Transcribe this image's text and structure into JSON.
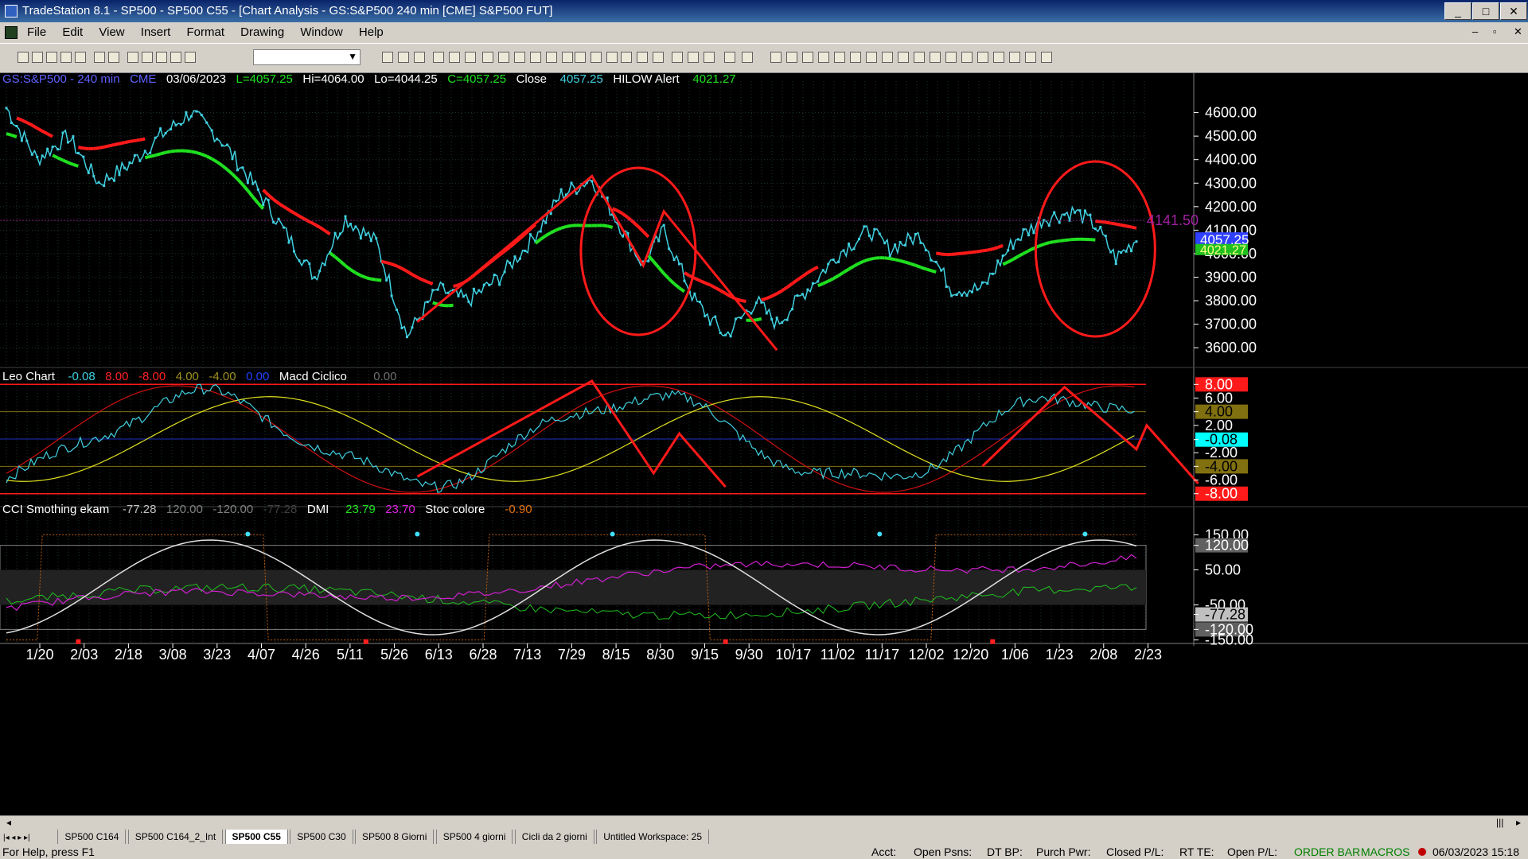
{
  "window": {
    "title": "TradeStation 8.1 - SP500 - SP500 C55 - [Chart Analysis - GS:S&P500  240 min  [CME] S&P500 FUT]"
  },
  "menu": [
    "File",
    "Edit",
    "View",
    "Insert",
    "Format",
    "Drawing",
    "Window",
    "Help"
  ],
  "header": {
    "symbol": "GS:S&P500 - 240 min",
    "exchange": "CME",
    "date": "03/06/2023",
    "low": "L=4057.25",
    "high": "Hi=4064.00",
    "lowp": "Lo=4044.25",
    "close": "C=4057.25",
    "close_label": "Close",
    "close_value": "4057.25",
    "alert_label": "HILOW Alert",
    "alert_value": "4021.27"
  },
  "panel2": {
    "label": "Leo Chart",
    "v1": "-0.08",
    "v2": "8.00",
    "v3": "-8.00",
    "v4": "4.00",
    "v5": "-4.00",
    "v6": "0.00",
    "macd": "Macd Ciclico",
    "macd_value": "0.00"
  },
  "panel3": {
    "label": "CCI Smothing ekam",
    "v1": "-77.28",
    "v2": "120.00",
    "v3": "-120.00",
    "v4": "-77.28",
    "dmi": "DMI",
    "dmi1": "23.79",
    "dmi2": "23.70",
    "stoc": "Stoc colore",
    "stoc_value": "-0.90"
  },
  "price_axis": {
    "ticks": [
      "4600.00",
      "4500.00",
      "4400.00",
      "4300.00",
      "4200.00",
      "4100.00",
      "4000.00",
      "3900.00",
      "3800.00",
      "3700.00",
      "3600.00"
    ],
    "last": "4057.25",
    "alert": "4021.27",
    "level": "4141.50"
  },
  "macd_axis": {
    "ticks": [
      "8.00",
      "6.00",
      "4.00",
      "2.00",
      "-0.08",
      "-2.00",
      "-4.00",
      "-6.00",
      "-8.00"
    ]
  },
  "cci_axis": {
    "ticks": [
      "150.00",
      "120.00",
      "50.00",
      "-50.00",
      "-77.28",
      "-120.00",
      "-150.00"
    ]
  },
  "date_axis": [
    "1/20",
    "2/03",
    "2/18",
    "3/08",
    "3/23",
    "4/07",
    "4/26",
    "5/11",
    "5/26",
    "6/13",
    "6/28",
    "7/13",
    "7/29",
    "8/15",
    "8/30",
    "9/15",
    "9/30",
    "10/17",
    "11/02",
    "11/17",
    "12/02",
    "12/20",
    "1/06",
    "1/23",
    "2/08",
    "2/23"
  ],
  "tabs": [
    "SP500 C164",
    "SP500 C164_2_Int",
    "SP500 C55",
    "SP500 C30",
    "SP500 8 Giorni",
    "SP500 4 giorni",
    "Cicli da 2 giorni",
    "Untitled Workspace:  25"
  ],
  "active_tab": "SP500 C55",
  "status": {
    "help": "For Help, press F1",
    "acct": "Acct:",
    "open_psns": "Open Psns:",
    "dt_bp": "DT BP:",
    "purch": "Purch Pwr:",
    "closed": "Closed P/L:",
    "rt_te": "RT TE:",
    "open_pl": "Open P/L:",
    "orderbar": "ORDER BAR",
    "macros": "MACROS",
    "datetime": "06/03/2023 15:18"
  },
  "colors": {
    "price": "#40d0e0",
    "upper_ma": "#ff1a1a",
    "lower_ma": "#20e020",
    "axis_text": "#ffffff",
    "grid": "#2a4a4a"
  },
  "chart_data": {
    "type": "line",
    "price_range": [
      3550,
      4700
    ],
    "price_keypoints": [
      [
        0,
        4620
      ],
      [
        3,
        4400
      ],
      [
        6,
        4500
      ],
      [
        9,
        4300
      ],
      [
        12,
        4380
      ],
      [
        15,
        4500
      ],
      [
        18,
        4600
      ],
      [
        21,
        4480
      ],
      [
        24,
        4300
      ],
      [
        27,
        4100
      ],
      [
        30,
        3900
      ],
      [
        33,
        4150
      ],
      [
        36,
        4050
      ],
      [
        39,
        3650
      ],
      [
        42,
        3850
      ],
      [
        45,
        3800
      ],
      [
        48,
        3900
      ],
      [
        51,
        4050
      ],
      [
        54,
        4250
      ],
      [
        57,
        4320
      ],
      [
        60,
        4100
      ],
      [
        62,
        3950
      ],
      [
        64,
        4100
      ],
      [
        67,
        3800
      ],
      [
        70,
        3650
      ],
      [
        73,
        3800
      ],
      [
        75,
        3700
      ],
      [
        78,
        3850
      ],
      [
        81,
        4000
      ],
      [
        84,
        4100
      ],
      [
        86,
        4020
      ],
      [
        89,
        4080
      ],
      [
        92,
        3850
      ],
      [
        95,
        3850
      ],
      [
        98,
        4050
      ],
      [
        101,
        4150
      ],
      [
        104,
        4180
      ],
      [
        106,
        4120
      ],
      [
        108,
        3980
      ],
      [
        110,
        4060
      ]
    ]
  }
}
